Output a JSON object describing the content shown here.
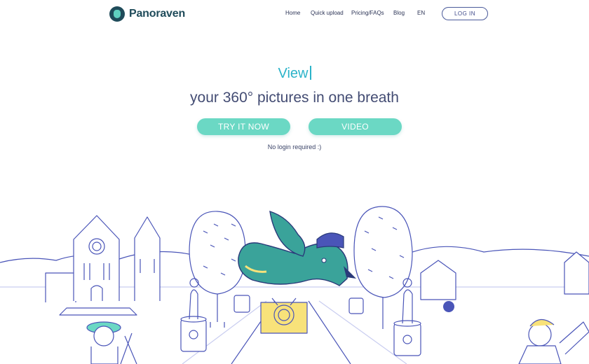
{
  "brand": {
    "name": "Panoraven"
  },
  "nav": {
    "items": [
      "Home",
      "Quick upload",
      "Pricing/FAQs",
      "Blog",
      "EN"
    ],
    "login": "LOG IN"
  },
  "hero": {
    "typed_word": "View",
    "tagline": "your 360° pictures in one breath",
    "try_button": "TRY IT NOW",
    "video_button": "VIDEO",
    "note": "No login required :)"
  },
  "colors": {
    "accent": "#6bd8c4",
    "typed": "#2bb3c9",
    "text": "#434c73",
    "illustration_line": "#4a55b8",
    "bird": "#3aa39a"
  }
}
